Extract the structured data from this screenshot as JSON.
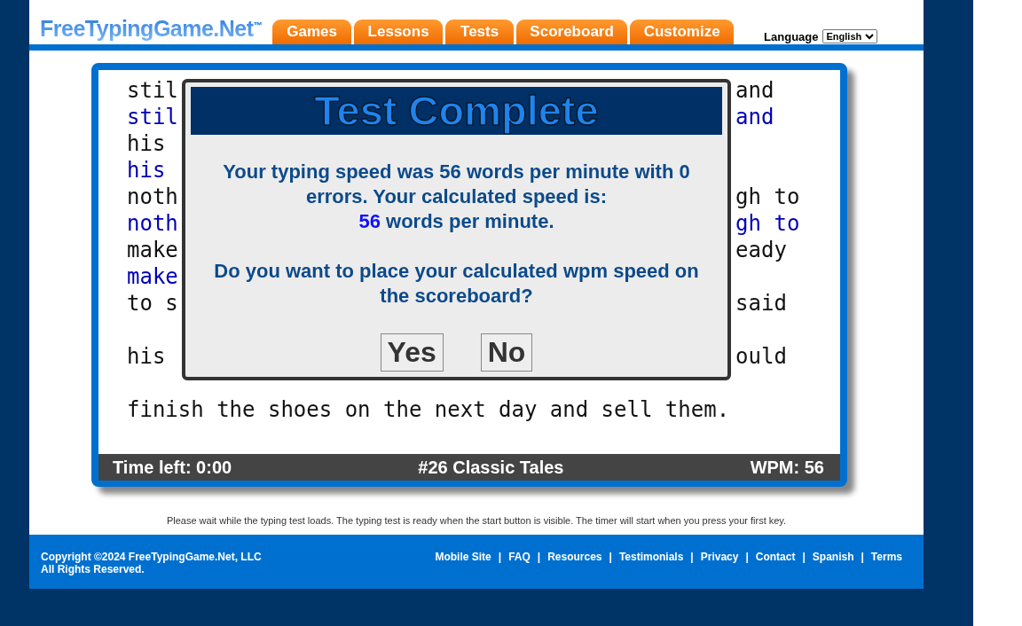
{
  "header": {
    "logo": "FreeTypingGame.Net$^{™}$",
    "tabs": [
      {
        "label": "Games",
        "selected": false
      },
      {
        "label": "Lessons",
        "selected": false
      },
      {
        "label": "Tests",
        "selected": false
      },
      {
        "label": "Scoreboard",
        "selected": false
      },
      {
        "label": "Customize",
        "selected": false
      }
    ],
    "language": {
      "label": "Language",
      "value": "English"
    }
  },
  "typing_area": {
    "lines": [
      {
        "kind": "source",
        "left": "stil",
        "right": "and"
      },
      {
        "kind": "typed",
        "left": "stil",
        "right": "and"
      },
      {
        "kind": "source",
        "left": "his"
      },
      {
        "kind": "typed",
        "left": "his"
      },
      {
        "kind": "source",
        "left": "noth",
        "right": "gh to"
      },
      {
        "kind": "typed",
        "left": "noth",
        "right": "gh to"
      },
      {
        "kind": "source",
        "left": "make",
        "right": "eady"
      },
      {
        "kind": "typed",
        "left": "make"
      },
      {
        "kind": "source",
        "left": "to s",
        "right": "said"
      },
      {
        "kind": "blank"
      },
      {
        "kind": "source",
        "left": "his",
        "right": "ould"
      },
      {
        "kind": "blank"
      },
      {
        "kind": "source",
        "left": "finish the shoes on the next day and sell them."
      }
    ],
    "status": {
      "time_left": "Time left: 0:00",
      "test_name": "#26 Classic Tales",
      "wpm": "WPM: 56"
    }
  },
  "dialog": {
    "title": "Test Complete",
    "message": "Your typing speed was 56 words per minute with 0 errors. Your calculated speed is:",
    "calculated_wpm": "56",
    "calculated_unit": "words per minute.",
    "question": "Do you want to place your calculated wpm speed on the scoreboard?",
    "buttons": [
      "Yes",
      "No"
    ]
  },
  "notice": "Please wait while the typing test loads. The typing test is ready when the start button is visible. The timer will start when you press your first key.",
  "footer": {
    "copyright": "Copyright ©2024 FreeTypingGame.Net, LLC",
    "rights": "All Rights Reserved.",
    "separator": "|",
    "links": [
      "Mobile Site",
      "FAQ",
      "Resources",
      "Testimonials",
      "Privacy",
      "Contact",
      "Spanish",
      "Terms"
    ]
  }
}
